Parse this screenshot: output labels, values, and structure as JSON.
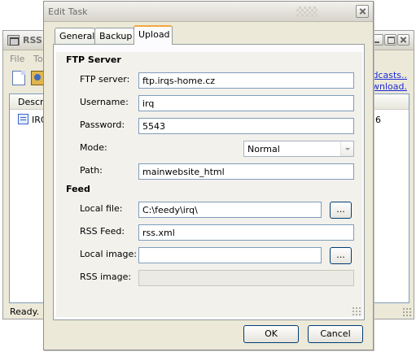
{
  "background_window": {
    "title": "RSS",
    "menu": [
      "File",
      "To"
    ],
    "links": [
      "odcasts..",
      "ownload."
    ],
    "list": {
      "column_header": "Descri",
      "row_text": "IRQ",
      "row_right": "6"
    },
    "status": "Ready."
  },
  "dialog": {
    "title": "Edit Task",
    "tabs": [
      {
        "label": "General"
      },
      {
        "label": "Backup"
      },
      {
        "label": "Upload"
      }
    ],
    "active_tab": "Upload",
    "ftp_section": {
      "title": "FTP Server",
      "server_label": "FTP server:",
      "server_value": "ftp.irqs-home.cz",
      "username_label": "Username:",
      "username_value": "irq",
      "password_label": "Password:",
      "password_value": "5543",
      "mode_label": "Mode:",
      "mode_value": "Normal",
      "path_label": "Path:",
      "path_value": "mainwebsite_html"
    },
    "feed_section": {
      "title": "Feed",
      "local_file_label": "Local file:",
      "local_file_value": "C:\\feedy\\irq\\",
      "rss_feed_label": "RSS Feed:",
      "rss_feed_value": "rss.xml",
      "local_image_label": "Local image:",
      "local_image_value": "",
      "rss_image_label": "RSS image:",
      "rss_image_value": "",
      "browse_label": "..."
    },
    "buttons": {
      "ok": "OK",
      "cancel": "Cancel"
    }
  }
}
